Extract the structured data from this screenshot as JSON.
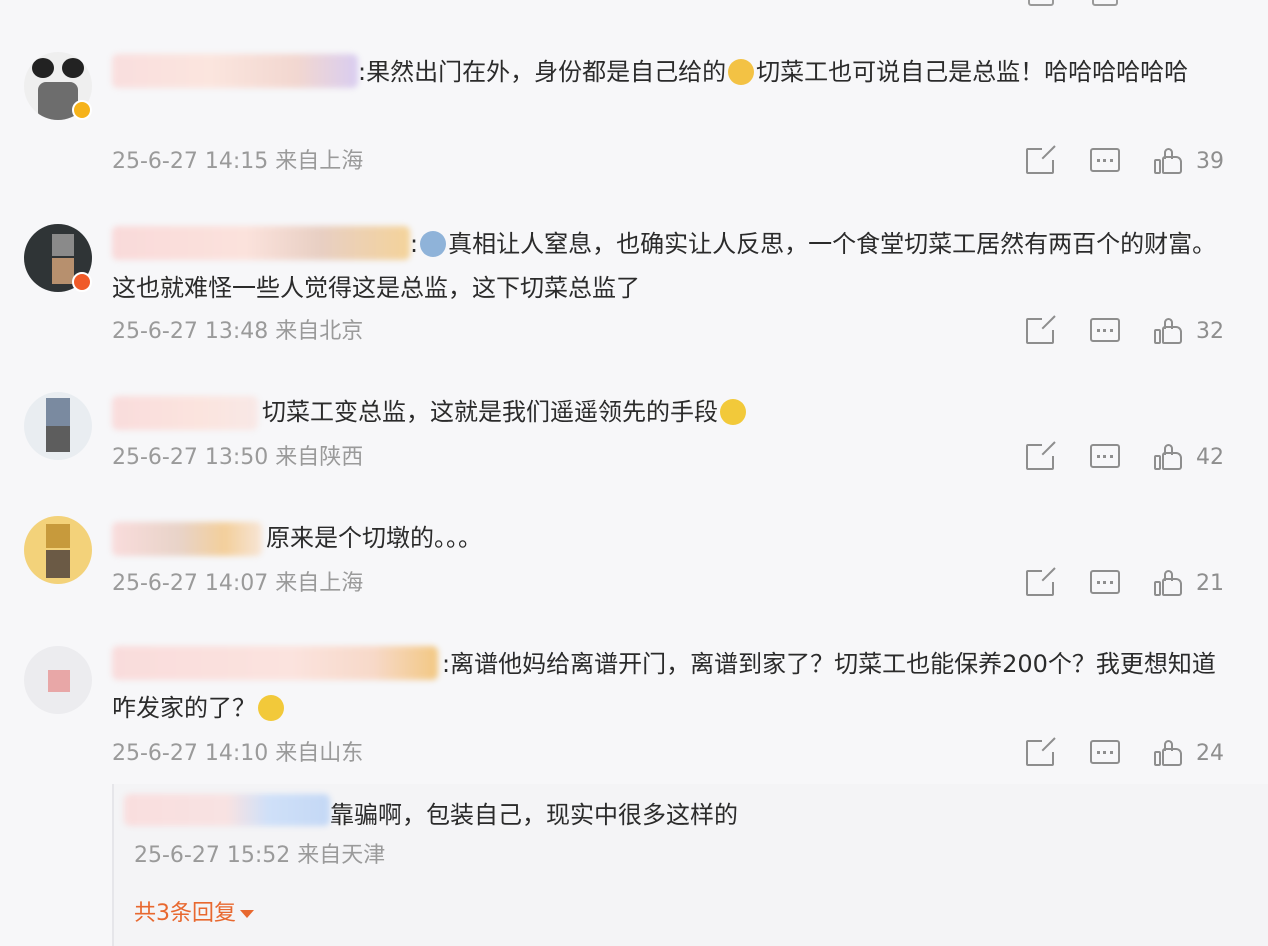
{
  "comments": [
    {
      "text": ":果然出门在外，身份都是自己给的",
      "text_after_emoji": "切菜工也可说自己是总监！哈哈哈哈哈哈",
      "meta": "25-6-27 14:15 来自上海",
      "likes": "39"
    },
    {
      "text": ":",
      "text_after_emoji": "真相让人窒息，也确实让人反思，一个食堂切菜工居然有两百个的财富。这也就难怪一些人觉得这是总监，这下切菜总监了",
      "meta": "25-6-27 13:48 来自北京",
      "likes": "32"
    },
    {
      "text": "切菜工变总监，这就是我们遥遥领先的手段",
      "meta": "25-6-27 13:50 来自陕西",
      "likes": "42"
    },
    {
      "text": "原来是个切墩的。。。",
      "meta": "25-6-27 14:07 来自上海",
      "likes": "21"
    },
    {
      "text": ":离谱他妈给离谱开门，离谱到家了？切菜工也能保养200个？我更想知道咋发家的了？",
      "meta": "25-6-27 14:10 来自山东",
      "likes": "24"
    }
  ],
  "reply": {
    "text": "靠骗啊，包装自己，现实中很多这样的",
    "meta": "25-6-27 15:52 来自天津",
    "more_label": "共3条回复"
  }
}
